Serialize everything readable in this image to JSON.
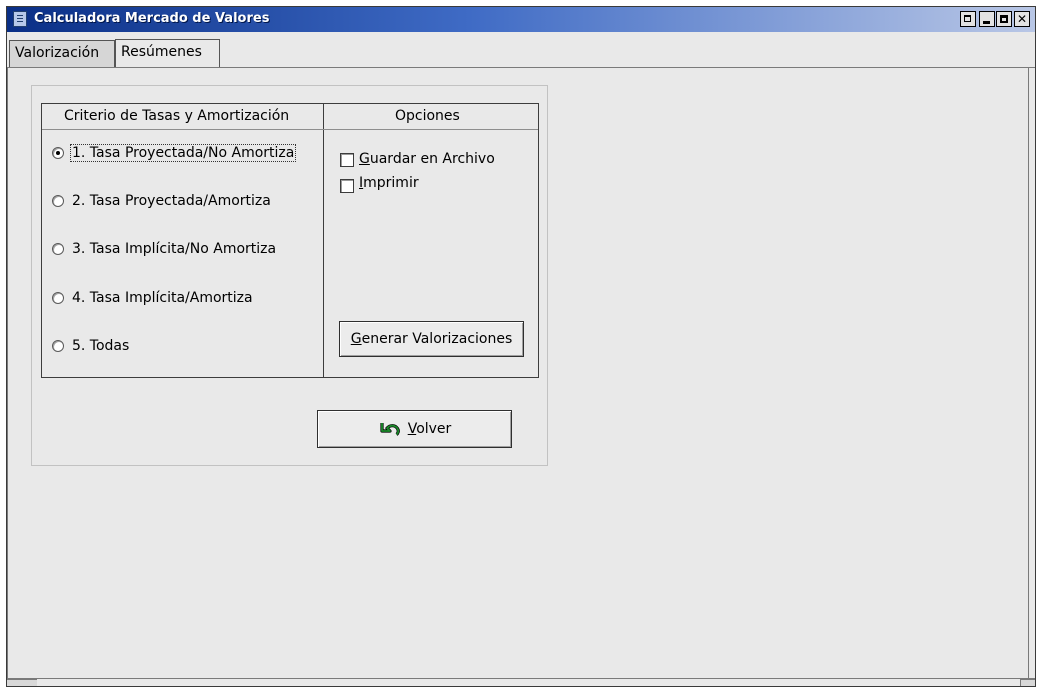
{
  "window": {
    "title": "Calculadora Mercado de Valores",
    "icons": {
      "app": "calculator-document-icon",
      "restore": "restore-icon",
      "minimize": "minimize-icon",
      "maximize": "maximize-icon",
      "close": "close-icon"
    }
  },
  "tabs": [
    {
      "label": "Valorización",
      "active": true
    },
    {
      "label": "Resúmenes",
      "active": false
    }
  ],
  "criteria": {
    "header": "Criterio de Tasas y Amortización",
    "options": [
      {
        "label": "1.  Tasa Proyectada/No Amortiza",
        "selected": true
      },
      {
        "label": "2.  Tasa Proyectada/Amortiza",
        "selected": false
      },
      {
        "label": "3.  Tasa Implícita/No Amortiza",
        "selected": false
      },
      {
        "label": "4.  Tasa Implícita/Amortiza",
        "selected": false
      },
      {
        "label": "5.  Todas",
        "selected": false
      }
    ]
  },
  "options": {
    "header": "Opciones",
    "save_to_file": {
      "mnemonic": "G",
      "rest": "uardar en Archivo",
      "checked": false
    },
    "print": {
      "mnemonic": "I",
      "rest": "mprimir",
      "checked": false
    },
    "generate": {
      "mnemonic": "G",
      "rest": "enerar Valorizaciones"
    }
  },
  "back": {
    "mnemonic": "V",
    "rest": "olver",
    "icon": "undo-arrow-icon",
    "icon_color": "#1a8a2a"
  }
}
